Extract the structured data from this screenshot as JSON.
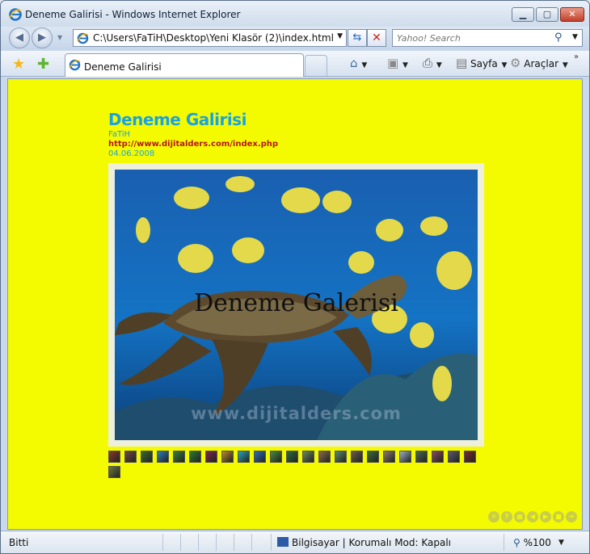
{
  "window": {
    "title": "Deneme Galirisi - Windows Internet Explorer"
  },
  "nav": {
    "address": "C:\\Users\\FaTiH\\Desktop\\Yeni Klasör (2)\\index.html",
    "search_placeholder": "Yahoo! Search"
  },
  "tab": {
    "label": "Deneme Galirisi"
  },
  "toolbar": {
    "home_icon": "home-icon",
    "feeds_icon": "rss-icon",
    "print_icon": "print-icon",
    "page_label": "Sayfa",
    "tools_label": "Araçlar"
  },
  "gallery": {
    "title": "Deneme Galirisi",
    "author": "FaTiH",
    "url": "http://www.dijitalders.com/index.php",
    "date": "04.06.2008",
    "caption": "Deneme Galerisi",
    "watermark": "www.dijitalders.com",
    "thumbnail_count": 24,
    "thumbnail_colors": [
      "#8a3a2a",
      "#6e4a3c",
      "#3d6b2a",
      "#2c7fb8",
      "#3a7d3a",
      "#2d7a2d",
      "#7a2a4a",
      "#b88a2a",
      "#2aa3b8",
      "#2a6fb8",
      "#4a8a3a",
      "#2d6d3d",
      "#6a8a5a",
      "#8a6a4a",
      "#5a8a6a",
      "#6a5a4a",
      "#3a6a3a",
      "#8a7a6a",
      "#9ab0c0",
      "#4a6a4a",
      "#8a4a5a",
      "#5a5a6a",
      "#7a2a2a",
      "#6a7a3a"
    ],
    "controls": [
      "close-icon",
      "help-icon",
      "grid-icon",
      "prev-icon",
      "play-icon",
      "stop-icon",
      "next-icon"
    ]
  },
  "status": {
    "left": "Bitti",
    "zone": "Bilgisayar | Korumalı Mod: Kapalı",
    "zoom": "%100"
  },
  "colors": {
    "page_bg": "#f4fb00",
    "title": "#1aa3e0",
    "url": "#b41717"
  }
}
